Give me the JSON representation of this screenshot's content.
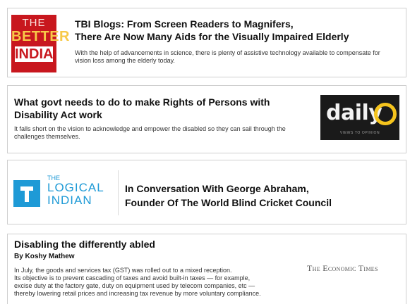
{
  "cards": [
    {
      "logo": {
        "line1": "THE",
        "line2": "BETTER",
        "line3": "INDIA"
      },
      "title_line1": "TBI Blogs: From Screen Readers to Magnifers,",
      "title_line2": "There Are Now Many Aids for the Visually Impaired Elderly",
      "description": "With the help of advancements in science, there is plenty of assistive technology available to compensate for vision loss among the elderly today."
    },
    {
      "title": "What govt needs to do to make Rights of Persons with Disability Act work",
      "description": "It falls short on the vision to acknowledge and empower the disabled so they can sail through the challenges themselves.",
      "logo": {
        "word": "daily",
        "tagline": "VIEWS TO OPINION"
      }
    },
    {
      "logo": {
        "line1": "THE",
        "line2": "LOGICAL",
        "line3": "INDIAN"
      },
      "title_line1": "In Conversation With George Abraham,",
      "title_line2": "Founder Of The World Blind Cricket Council"
    },
    {
      "title": "Disabling the differently abled",
      "byline": "By Koshy Mathew",
      "description_lines": [
        "In July, the goods and services tax (GST) was rolled out to a mixed reception.",
        "Its objective is to prevent cascading of taxes and avoid built-in taxes — for example,",
        "excise duty at the factory gate, duty on equipment used by telecom companies, etc —",
        "thereby lowering retail prices and increasing tax revenue by more voluntary compliance."
      ],
      "logo": {
        "text": "The Economic Times"
      }
    }
  ],
  "colors": {
    "tbi_red": "#c8171e",
    "tbi_yellow": "#f7c948",
    "dailyo_yellow": "#f4c31d",
    "logical_indian_blue": "#1e9ad6"
  },
  "icons": {
    "tbi": "the-better-india-logo",
    "dailyo": "dailyo-logo",
    "tli": "the-logical-indian-logo",
    "et": "economic-times-logo"
  }
}
